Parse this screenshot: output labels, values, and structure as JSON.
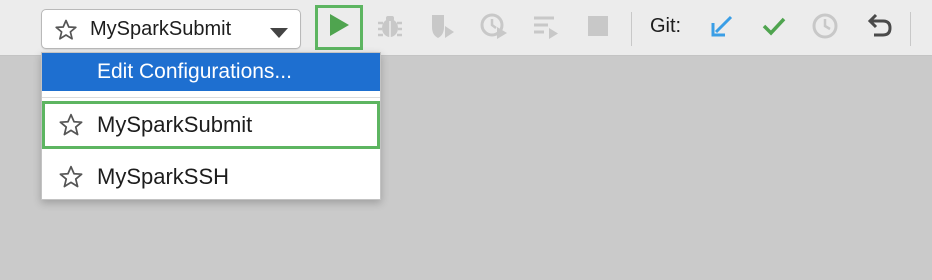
{
  "toolbar": {
    "config_selector": {
      "value": "MySparkSubmit",
      "icon": "star-outline-icon"
    },
    "actions": [
      {
        "name": "run",
        "icon": "play-icon",
        "color": "#4fa44f"
      },
      {
        "name": "debug",
        "icon": "bug-icon"
      },
      {
        "name": "coverage",
        "icon": "coverage-shield-icon"
      },
      {
        "name": "profile",
        "icon": "profiler-clock-icon"
      },
      {
        "name": "run-list",
        "icon": "list-run-icon"
      },
      {
        "name": "stop",
        "icon": "stop-square-icon"
      }
    ],
    "git": {
      "label": "Git:",
      "update_icon": "arrow-down-left-icon",
      "update_color": "#3a9ee6",
      "commit_icon": "checkmark-icon",
      "commit_color": "#4fa44f",
      "history_icon": "clock-icon",
      "revert_icon": "undo-arrow-icon"
    }
  },
  "dropdown": {
    "header": "Edit Configurations...",
    "highlight_color": "#1e6fd0",
    "annotation_color": "#5db561",
    "items": [
      {
        "label": "MySparkSubmit",
        "icon": "star-outline-icon",
        "annotated": true
      },
      {
        "label": "MySparkSSH",
        "icon": "star-outline-icon",
        "annotated": false
      }
    ]
  }
}
